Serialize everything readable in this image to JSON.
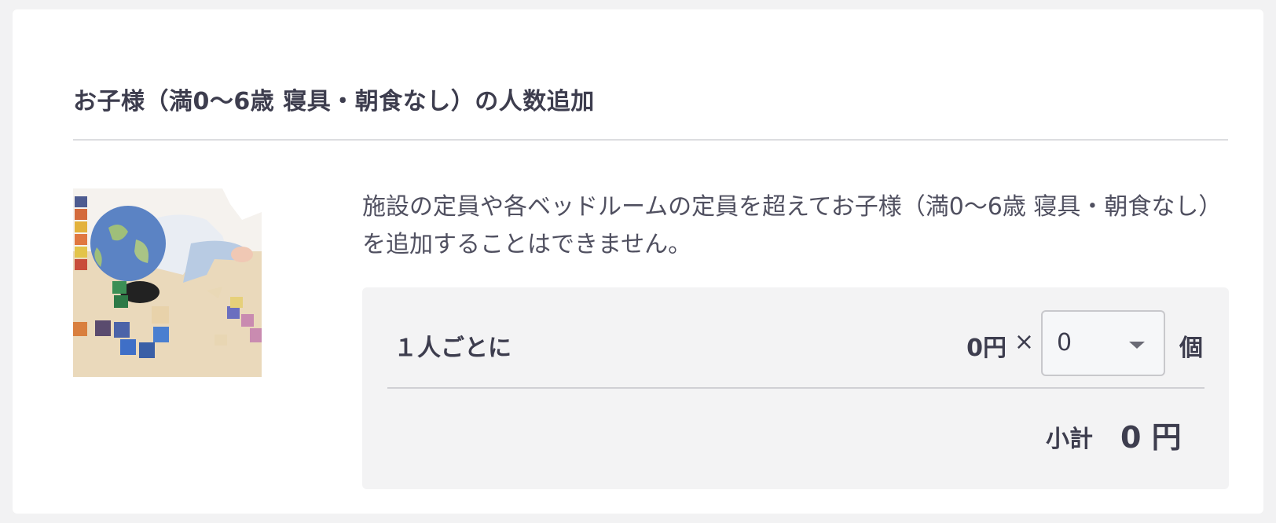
{
  "section": {
    "title": "お子様（満0〜6歳 寝具・朝食なし）の人数追加",
    "description": "施設の定員や各ベッドルームの定員を超えてお子様（満0〜6歳 寝具・朝食なし）を追加することはできません。"
  },
  "pricing": {
    "per_person_label": "１人ごとに",
    "unit_price": "0円",
    "times_symbol": "×",
    "quantity": "0",
    "counter_unit": "個",
    "subtotal_label": "小計",
    "subtotal_value": "0 円"
  },
  "icons": {
    "dropdown": "chevron-down-icon"
  },
  "colors": {
    "text": "#3d3d4e",
    "price_box_bg": "#f3f3f4",
    "divider": "#dcdde0",
    "outer_bg": "#f2f2f3"
  }
}
